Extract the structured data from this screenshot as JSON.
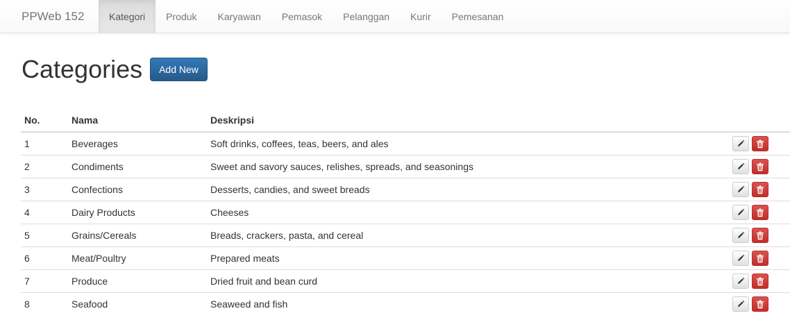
{
  "navbar": {
    "brand": "PPWeb 152",
    "items": [
      {
        "label": "Kategori",
        "active": true
      },
      {
        "label": "Produk",
        "active": false
      },
      {
        "label": "Karyawan",
        "active": false
      },
      {
        "label": "Pemasok",
        "active": false
      },
      {
        "label": "Pelanggan",
        "active": false
      },
      {
        "label": "Kurir",
        "active": false
      },
      {
        "label": "Pemesanan",
        "active": false
      }
    ]
  },
  "page": {
    "title": "Categories",
    "add_button_label": "Add New"
  },
  "table": {
    "headers": [
      "No.",
      "Nama",
      "Deskripsi"
    ],
    "rows": [
      {
        "no": "1",
        "nama": "Beverages",
        "deskripsi": "Soft drinks, coffees, teas, beers, and ales"
      },
      {
        "no": "2",
        "nama": "Condiments",
        "deskripsi": "Sweet and savory sauces, relishes, spreads, and seasonings"
      },
      {
        "no": "3",
        "nama": "Confections",
        "deskripsi": "Desserts, candies, and sweet breads"
      },
      {
        "no": "4",
        "nama": "Dairy Products",
        "deskripsi": "Cheeses"
      },
      {
        "no": "5",
        "nama": "Grains/Cereals",
        "deskripsi": "Breads, crackers, pasta, and cereal"
      },
      {
        "no": "6",
        "nama": "Meat/Poultry",
        "deskripsi": "Prepared meats"
      },
      {
        "no": "7",
        "nama": "Produce",
        "deskripsi": "Dried fruit and bean curd"
      },
      {
        "no": "8",
        "nama": "Seafood",
        "deskripsi": "Seaweed and fish"
      }
    ],
    "row_actions": {
      "edit_icon": "pencil-icon",
      "delete_icon": "trash-icon"
    }
  },
  "colors": {
    "primary": "#337ab7",
    "danger": "#d9534f",
    "navbar_bg": "#f8f8f8"
  }
}
